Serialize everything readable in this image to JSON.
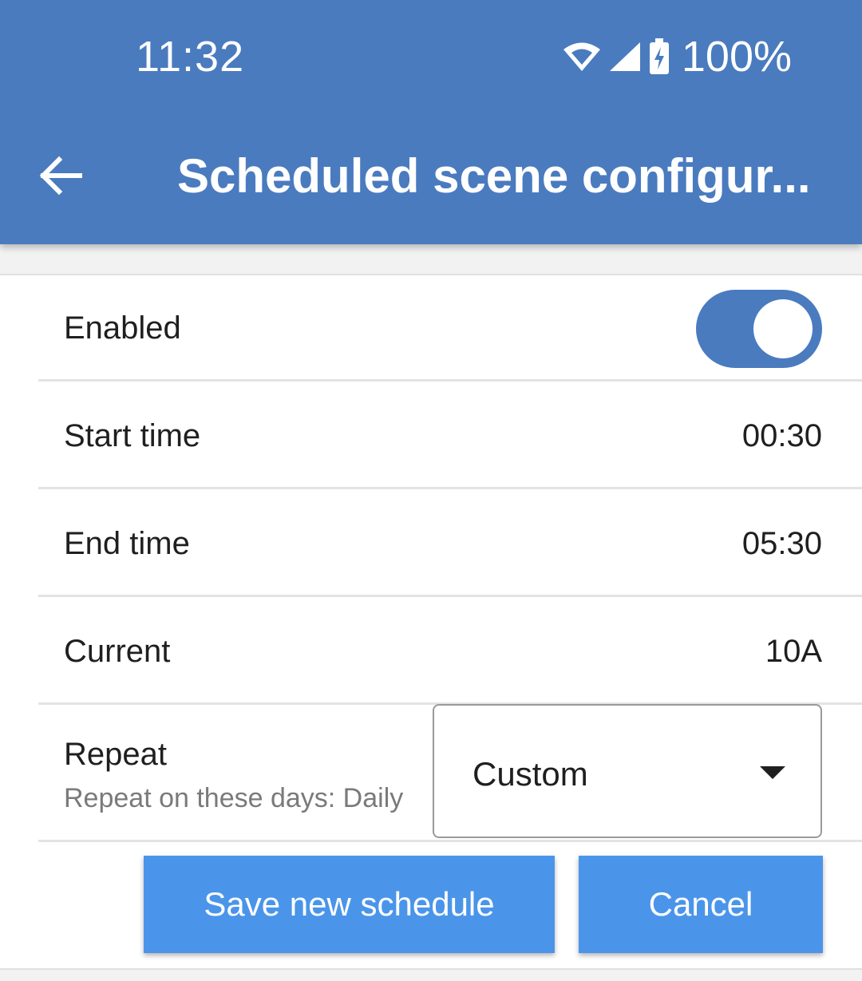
{
  "status_bar": {
    "time": "11:32",
    "battery_percent": "100%",
    "icons": [
      "wifi-icon",
      "signal-icon",
      "battery-charging-icon"
    ]
  },
  "app_bar": {
    "title": "Scheduled scene configur...",
    "back_icon": "arrow-left-icon",
    "color": "#4a7bbf"
  },
  "form": {
    "enabled": {
      "label": "Enabled",
      "on": true
    },
    "start_time": {
      "label": "Start time",
      "value": "00:30"
    },
    "end_time": {
      "label": "End time",
      "value": "05:30"
    },
    "current": {
      "label": "Current",
      "value": "10A"
    },
    "repeat": {
      "label": "Repeat",
      "sublabel": "Repeat on these days: Daily",
      "selected": "Custom"
    }
  },
  "actions": {
    "save_label": "Save new schedule",
    "cancel_label": "Cancel",
    "button_color": "#4a95ea"
  }
}
